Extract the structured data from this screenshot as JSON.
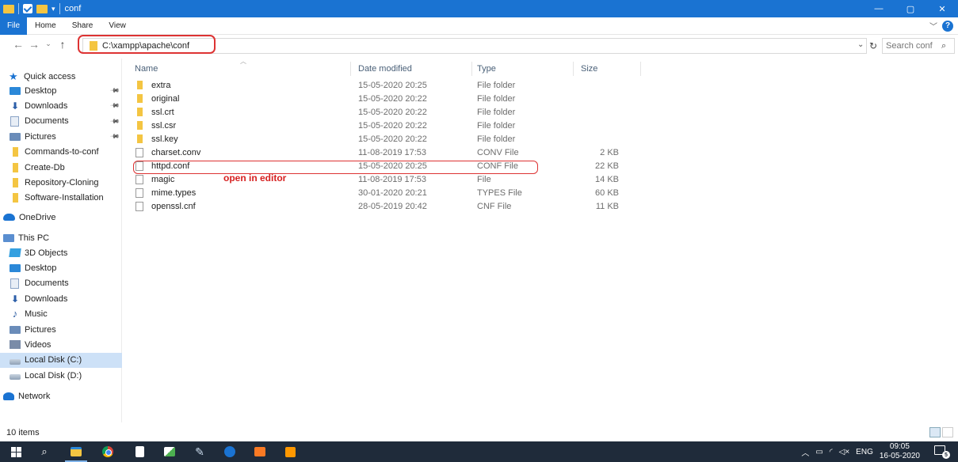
{
  "window": {
    "title": "conf",
    "controls": {
      "minimize": "—",
      "maximize": "▢",
      "close": "✕"
    }
  },
  "ribbon": {
    "tabs": [
      "File",
      "Home",
      "Share",
      "View"
    ],
    "help": "?"
  },
  "address": {
    "path": "C:\\xampp\\apache\\conf",
    "search_placeholder": "Search conf"
  },
  "sidebar": {
    "quick_access": "Quick access",
    "quick_items": [
      {
        "label": "Desktop",
        "icon": "desktop-icon",
        "pinned": true
      },
      {
        "label": "Downloads",
        "icon": "download-icon",
        "pinned": true
      },
      {
        "label": "Documents",
        "icon": "documents-icon",
        "pinned": true
      },
      {
        "label": "Pictures",
        "icon": "pictures-icon",
        "pinned": true
      },
      {
        "label": "Commands-to-conf",
        "icon": "folder-icon",
        "pinned": false
      },
      {
        "label": "Create-Db",
        "icon": "folder-icon",
        "pinned": false
      },
      {
        "label": "Repository-Cloning",
        "icon": "folder-icon",
        "pinned": false
      },
      {
        "label": "Software-Installation",
        "icon": "folder-icon",
        "pinned": false
      }
    ],
    "onedrive": "OneDrive",
    "this_pc": "This PC",
    "pc_items": [
      {
        "label": "3D Objects",
        "icon": "3d-objects-icon"
      },
      {
        "label": "Desktop",
        "icon": "desktop-icon"
      },
      {
        "label": "Documents",
        "icon": "documents-icon"
      },
      {
        "label": "Downloads",
        "icon": "download-icon"
      },
      {
        "label": "Music",
        "icon": "music-icon"
      },
      {
        "label": "Pictures",
        "icon": "pictures-icon"
      },
      {
        "label": "Videos",
        "icon": "videos-icon"
      },
      {
        "label": "Local Disk (C:)",
        "icon": "disk-icon",
        "selected": true
      },
      {
        "label": "Local Disk (D:)",
        "icon": "disk-icon"
      }
    ],
    "network": "Network"
  },
  "columns": {
    "name": "Name",
    "date": "Date modified",
    "type": "Type",
    "size": "Size"
  },
  "files": [
    {
      "name": "extra",
      "date": "15-05-2020 20:25",
      "type": "File folder",
      "size": "",
      "kind": "folder"
    },
    {
      "name": "original",
      "date": "15-05-2020 20:22",
      "type": "File folder",
      "size": "",
      "kind": "folder"
    },
    {
      "name": "ssl.crt",
      "date": "15-05-2020 20:22",
      "type": "File folder",
      "size": "",
      "kind": "folder"
    },
    {
      "name": "ssl.csr",
      "date": "15-05-2020 20:22",
      "type": "File folder",
      "size": "",
      "kind": "folder"
    },
    {
      "name": "ssl.key",
      "date": "15-05-2020 20:22",
      "type": "File folder",
      "size": "",
      "kind": "folder"
    },
    {
      "name": "charset.conv",
      "date": "11-08-2019 17:53",
      "type": "CONV File",
      "size": "2 KB",
      "kind": "file"
    },
    {
      "name": "httpd.conf",
      "date": "15-05-2020 20:25",
      "type": "CONF File",
      "size": "22 KB",
      "kind": "file"
    },
    {
      "name": "magic",
      "date": "11-08-2019 17:53",
      "type": "File",
      "size": "14 KB",
      "kind": "file"
    },
    {
      "name": "mime.types",
      "date": "30-01-2020 20:21",
      "type": "TYPES File",
      "size": "60 KB",
      "kind": "file"
    },
    {
      "name": "openssl.cnf",
      "date": "28-05-2019 20:42",
      "type": "CNF File",
      "size": "11 KB",
      "kind": "file"
    }
  ],
  "annotation": "open in editor",
  "status": {
    "items": "10 items"
  },
  "taskbar": {
    "apps": [
      "start-icon",
      "search-icon",
      "file-explorer-icon",
      "chrome-icon",
      "notepad-icon",
      "paint-icon",
      "app-icon",
      "maps-icon",
      "xampp-icon",
      "sublime-icon"
    ],
    "language": "ENG",
    "time": "09:05",
    "date": "16-05-2020",
    "notifications": "5"
  },
  "colors": {
    "accent": "#1a73d2",
    "highlight": "#d33333",
    "taskbar": "#1f2b3a",
    "folder": "#f4c542",
    "selection": "#cde1f7"
  }
}
